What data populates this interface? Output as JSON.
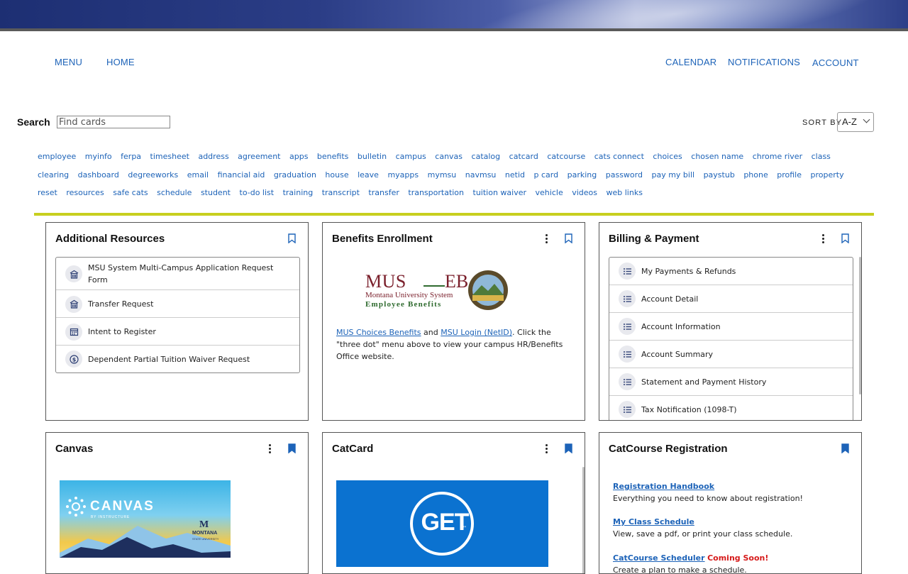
{
  "nav": {
    "menu": "MENU",
    "home": "HOME",
    "calendar": "CALENDAR",
    "notifications": "NOTIFICATIONS",
    "account": "ACCOUNT"
  },
  "search": {
    "label": "Search",
    "placeholder": "Find cards",
    "value": ""
  },
  "sort": {
    "label": "SORT BY",
    "value": "A-Z"
  },
  "tags": [
    "employee",
    "myinfo",
    "ferpa",
    "timesheet",
    "address",
    "agreement",
    "apps",
    "benefits",
    "bulletin",
    "campus",
    "canvas",
    "catalog",
    "catcard",
    "catcourse",
    "cats connect",
    "choices",
    "chosen name",
    "chrome river",
    "class",
    "clearing",
    "dashboard",
    "degreeworks",
    "email",
    "financial aid",
    "graduation",
    "house",
    "leave",
    "myapps",
    "mymsu",
    "navmsu",
    "netid",
    "p card",
    "parking",
    "password",
    "pay my bill",
    "paystub",
    "phone",
    "profile",
    "property",
    "reset",
    "resources",
    "safe cats",
    "schedule",
    "student",
    "to-do list",
    "training",
    "transcript",
    "transfer",
    "transportation",
    "tuition waiver",
    "vehicle",
    "videos",
    "web links"
  ],
  "colors": {
    "link": "#1d63b8",
    "accent_divider": "#c7cf1f",
    "coming_soon": "#d61a1a"
  },
  "cards": {
    "additional_resources": {
      "title": "Additional Resources",
      "items": [
        {
          "label": "MSU System Multi-Campus Application Request Form",
          "icon": "building-icon"
        },
        {
          "label": "Transfer Request",
          "icon": "building-icon"
        },
        {
          "label": "Intent to Register",
          "icon": "calendar-icon"
        },
        {
          "label": "Dependent Partial Tuition Waiver Request",
          "icon": "dollar-icon"
        }
      ]
    },
    "benefits": {
      "title": "Benefits Enrollment",
      "logo_main": "MUS",
      "logo_eb": "EB",
      "logo_line1": "Montana University System",
      "logo_line2": "Employee Benefits",
      "link1": "MUS Choices Benefits",
      "and": " and ",
      "link2": "MSU Login (NetID)",
      "text": ". Click the \"three dot\" menu above to view your campus HR/Benefits Office website."
    },
    "billing": {
      "title": "Billing & Payment",
      "items": [
        "My Payments & Refunds",
        "Account Detail",
        "Account Information",
        "Account Summary",
        "Statement and Payment History",
        "Tax Notification (1098-T)"
      ]
    },
    "canvas": {
      "title": "Canvas",
      "logo_text": "CANVAS",
      "logo_sub": "BY INSTRUCTURE",
      "msu_text1": "MONTANA",
      "msu_text2": "STATE UNIVERSITY"
    },
    "catcard": {
      "title": "CatCard",
      "logo_text": "GET",
      "tm": "™"
    },
    "catcourse": {
      "title": "CatCourse Registration",
      "blocks": [
        {
          "title": "Registration Handbook",
          "desc": "Everything you need to know about registration!"
        },
        {
          "title": "My Class Schedule",
          "desc": "View, save a pdf, or print your class schedule."
        },
        {
          "title": "CatCourse Scheduler",
          "badge": "Coming Soon!",
          "desc": "Create a plan to make a schedule."
        }
      ]
    }
  }
}
